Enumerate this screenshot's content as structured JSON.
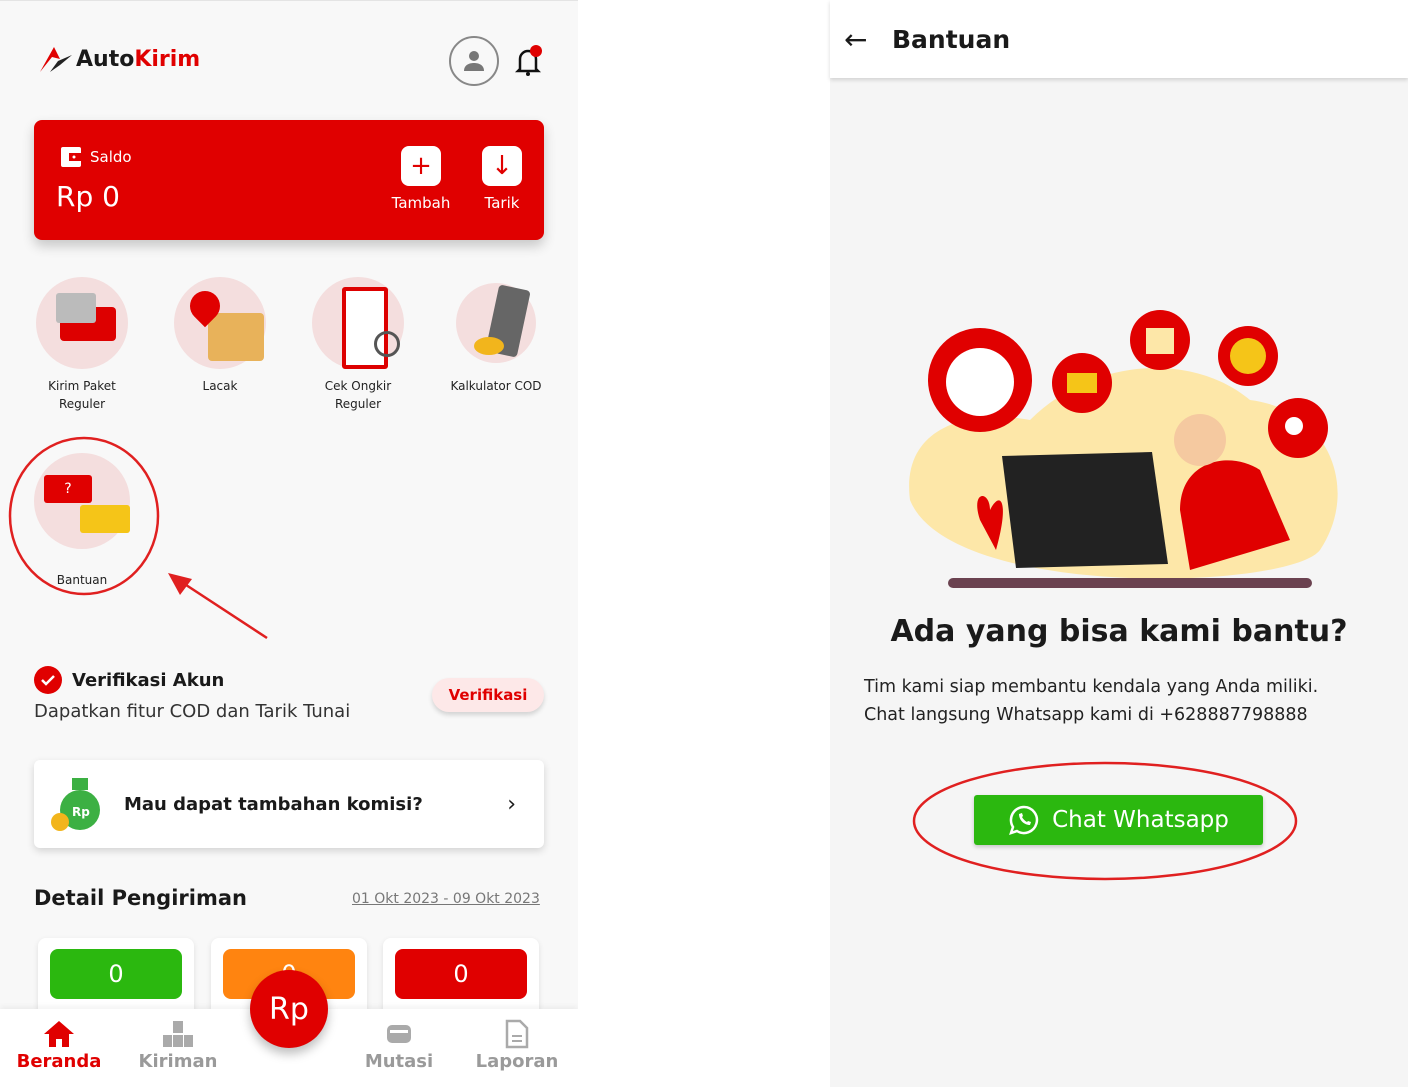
{
  "left": {
    "brand": {
      "part1": "Auto",
      "part2": "Kirim"
    },
    "saldo": {
      "label": "Saldo",
      "amount": "Rp 0",
      "add_label": "Tambah",
      "withdraw_label": "Tarik"
    },
    "menu": [
      {
        "label": "Kirim Paket Reguler",
        "icon": "truck-icon"
      },
      {
        "label": "Lacak",
        "icon": "location-package-icon"
      },
      {
        "label": "Cek Ongkir Reguler",
        "icon": "clipboard-search-icon"
      },
      {
        "label": "Kalkulator COD",
        "icon": "calculator-coins-icon"
      },
      {
        "label": "Bantuan",
        "icon": "chat-bubbles-icon"
      }
    ],
    "verifikasi": {
      "title": "Verifikasi Akun",
      "desc": "Dapatkan fitur COD dan Tarik Tunai",
      "button": "Verifikasi"
    },
    "komisi": {
      "text": "Mau dapat tambahan komisi?"
    },
    "detail": {
      "title": "Detail Pengiriman",
      "date_range": "01 Okt 2023 - 09 Okt 2023",
      "counts": [
        "0",
        "0",
        "0"
      ]
    },
    "nav": [
      {
        "label": "Beranda",
        "active": true
      },
      {
        "label": "Kiriman"
      },
      {
        "label": "Rp"
      },
      {
        "label": "Mutasi"
      },
      {
        "label": "Laporan"
      }
    ]
  },
  "right": {
    "title": "Bantuan",
    "heading": "Ada yang bisa kami bantu?",
    "line1": "Tim kami siap membantu kendala yang Anda miliki.",
    "line2": "Chat langsung Whatsapp kami di +628887798888",
    "button": "Chat Whatsapp"
  },
  "colors": {
    "primary": "#e00000",
    "green": "#2bb80f",
    "orange": "#ff8410",
    "annotation": "#e02020"
  }
}
